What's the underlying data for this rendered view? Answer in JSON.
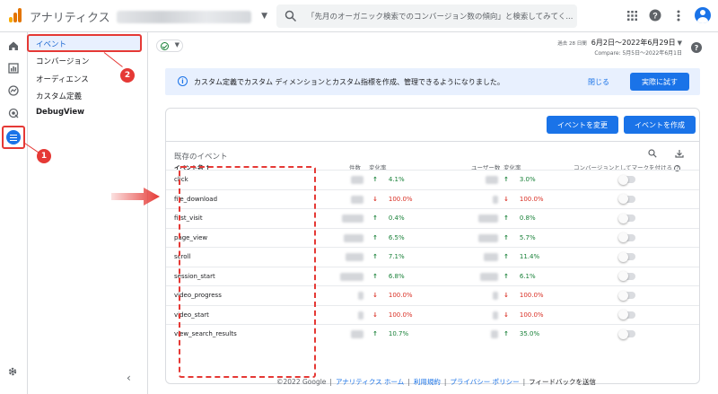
{
  "colors": {
    "accent": "#1a73e8",
    "annotation": "#e53935",
    "up": "#188038",
    "down": "#d93025"
  },
  "topbar": {
    "app_title": "アナリティクス",
    "search_placeholder": "「先月のオーガニック検索でのコンバージョン数の傾向」と検索してみてく..."
  },
  "rail": {
    "items": [
      "home-icon",
      "reports-icon",
      "explore-icon",
      "advertising-icon",
      "configure-icon"
    ],
    "settings_icon": "gear-icon"
  },
  "submenu": {
    "items": [
      "イベント",
      "コンバージョン",
      "オーディエンス",
      "カスタム定義",
      "DebugView"
    ],
    "active": "イベント"
  },
  "markers": [
    "1",
    "2"
  ],
  "date": {
    "prefix": "過去 28 日間",
    "range": "6月2日～2022年6月29日",
    "compare": "Compare: 5月5日～2022年6月1日"
  },
  "banner": {
    "text": "カスタム定義でカスタム ディメンションとカスタム指標を作成、管理できるようになりました。",
    "close": "閉じる",
    "try": "実際に試す"
  },
  "card": {
    "modify_button": "イベントを変更",
    "create_button": "イベントを作成",
    "title": "既存のイベント",
    "columns": {
      "name": "イベント名",
      "count": "件数",
      "change1": "変化率",
      "users": "ユーザー数",
      "change2": "変化率",
      "conversion": "コンバージョンとしてマークを付ける"
    },
    "rows": [
      {
        "name": "click",
        "change": "4.1%",
        "change_dir": "up",
        "user_change": "3.0%",
        "user_dir": "up"
      },
      {
        "name": "file_download",
        "change": "100.0%",
        "change_dir": "down",
        "user_change": "100.0%",
        "user_dir": "down"
      },
      {
        "name": "first_visit",
        "change": "0.4%",
        "change_dir": "up",
        "user_change": "0.8%",
        "user_dir": "up"
      },
      {
        "name": "page_view",
        "change": "6.5%",
        "change_dir": "up",
        "user_change": "5.7%",
        "user_dir": "up"
      },
      {
        "name": "scroll",
        "change": "7.1%",
        "change_dir": "up",
        "user_change": "11.4%",
        "user_dir": "up"
      },
      {
        "name": "session_start",
        "change": "6.8%",
        "change_dir": "up",
        "user_change": "6.1%",
        "user_dir": "up"
      },
      {
        "name": "video_progress",
        "change": "100.0%",
        "change_dir": "down",
        "user_change": "100.0%",
        "user_dir": "down"
      },
      {
        "name": "video_start",
        "change": "100.0%",
        "change_dir": "down",
        "user_change": "100.0%",
        "user_dir": "down"
      },
      {
        "name": "view_search_results",
        "change": "10.7%",
        "change_dir": "up",
        "user_change": "35.0%",
        "user_dir": "up"
      }
    ]
  },
  "footer": {
    "copyright": "©2022 Google",
    "links": [
      "アナリティクス ホーム",
      "利用規約",
      "プライバシー ポリシー"
    ],
    "feedback": "フィードバックを送信"
  }
}
